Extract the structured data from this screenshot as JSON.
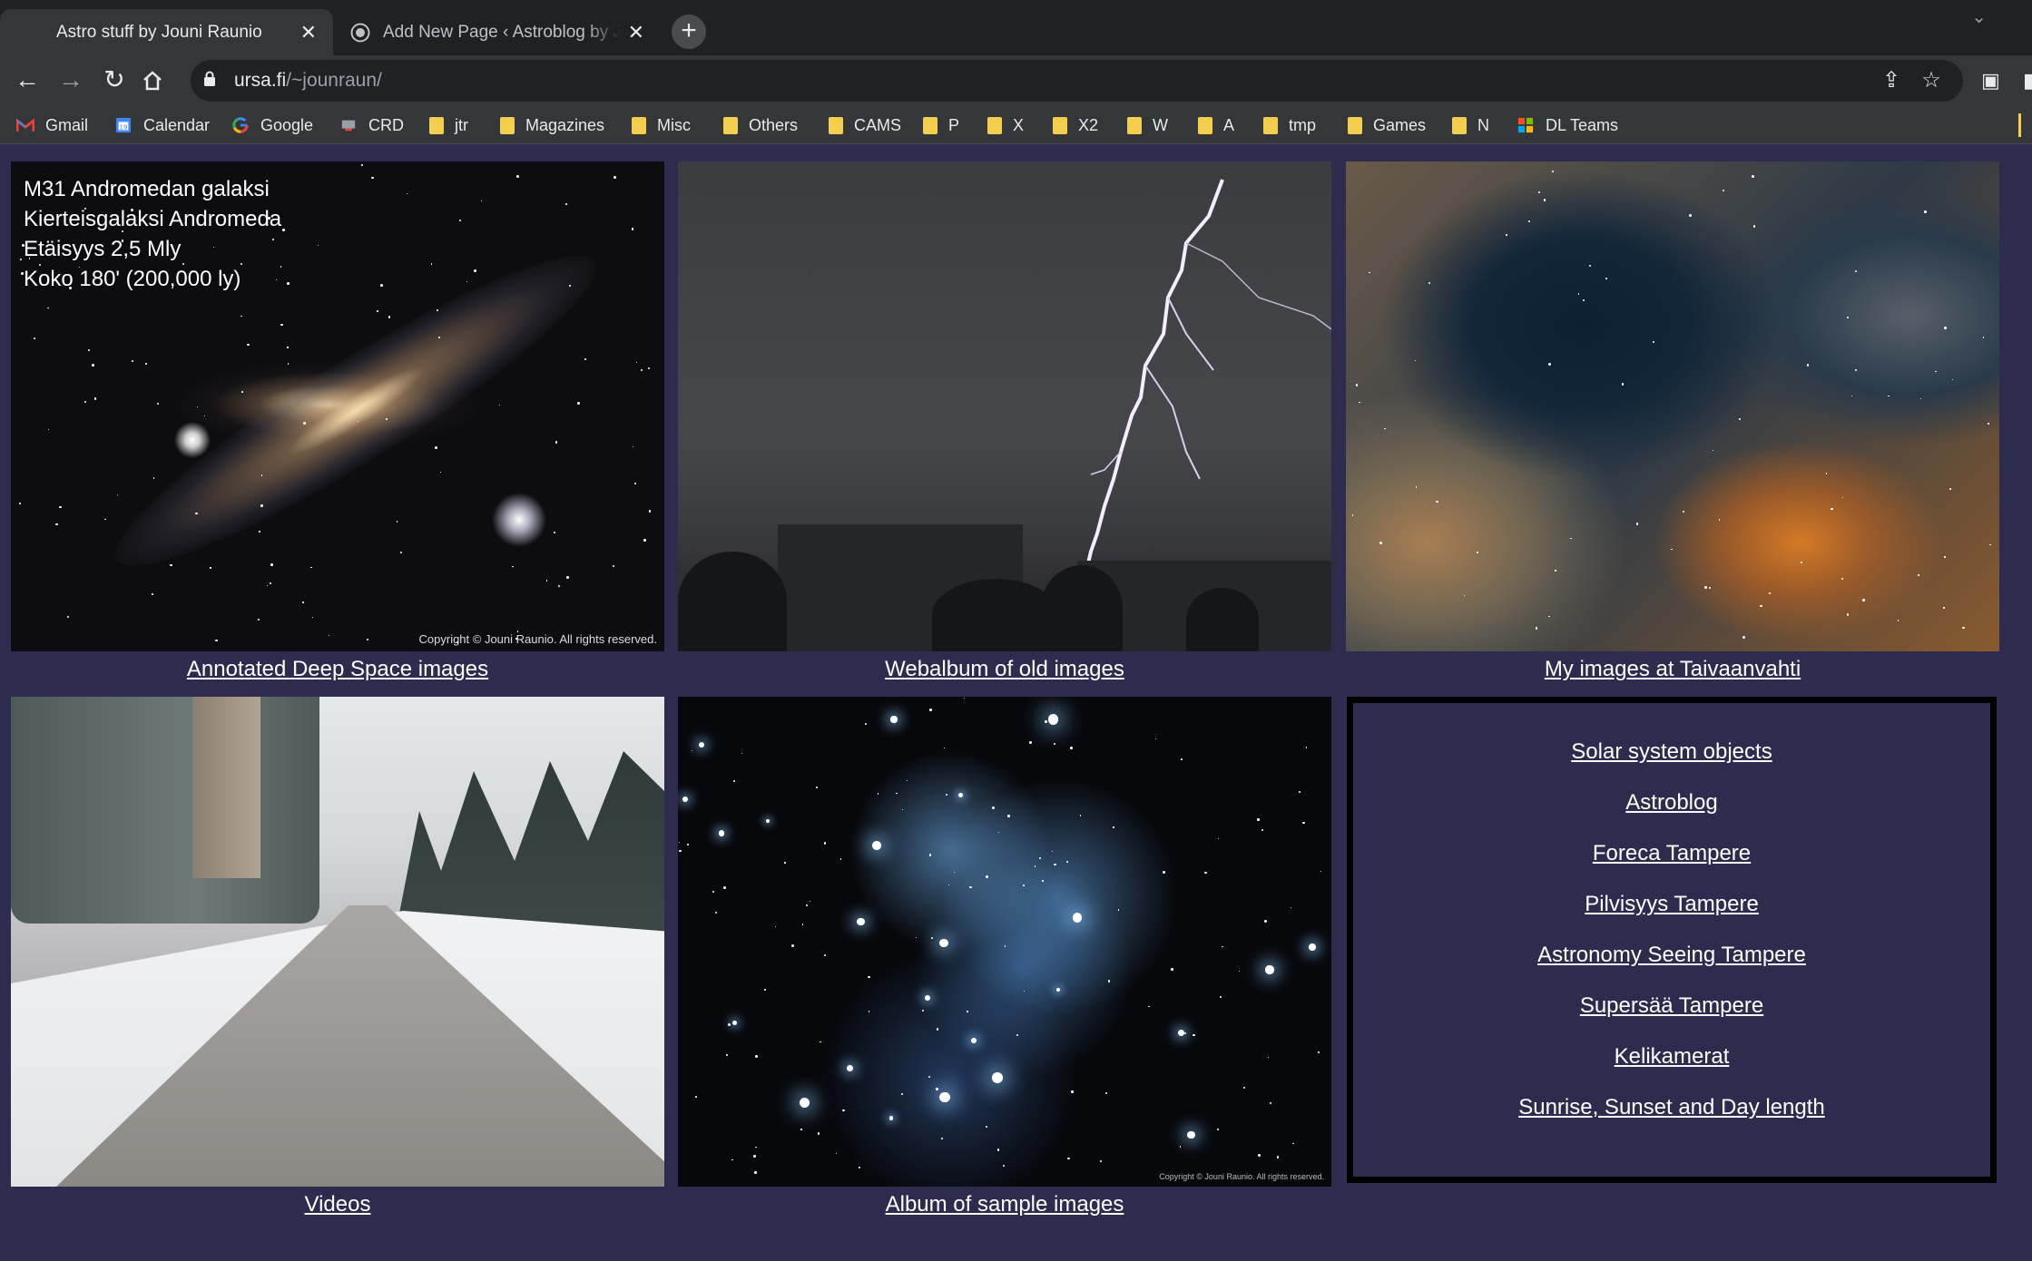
{
  "tabs": [
    {
      "title": "Astro stuff by Jouni Raunio",
      "active": true
    },
    {
      "title": "Add New Page ‹ Astroblog by Jouni Raunio",
      "active": false
    }
  ],
  "omnibox": {
    "host": "ursa.fi",
    "path": "/~jounraun/"
  },
  "bookmarks": [
    {
      "label": "Gmail",
      "icon": "gmail-icon"
    },
    {
      "label": "Calendar",
      "icon": "calendar-icon"
    },
    {
      "label": "Google",
      "icon": "google-icon"
    },
    {
      "label": "CRD",
      "icon": "crd-icon"
    },
    {
      "label": "jtr",
      "icon": "folder-icon"
    },
    {
      "label": "Magazines",
      "icon": "folder-icon"
    },
    {
      "label": "Misc",
      "icon": "folder-icon"
    },
    {
      "label": "Others",
      "icon": "folder-icon"
    },
    {
      "label": "CAMS",
      "icon": "folder-icon"
    },
    {
      "label": "P",
      "icon": "folder-icon"
    },
    {
      "label": "X",
      "icon": "folder-icon"
    },
    {
      "label": "X2",
      "icon": "folder-icon"
    },
    {
      "label": "W",
      "icon": "folder-icon"
    },
    {
      "label": "A",
      "icon": "folder-icon"
    },
    {
      "label": "tmp",
      "icon": "folder-icon"
    },
    {
      "label": "Games",
      "icon": "folder-icon"
    },
    {
      "label": "N",
      "icon": "folder-icon"
    },
    {
      "label": "DL Teams",
      "icon": "microsoft-icon"
    }
  ],
  "overlay": {
    "line1": "M31 Andromedan galaksi",
    "line2": "Kierteisgalaksi Andromeda",
    "line3": "Etäisyys 2,5 Mly",
    "line4": "Koko 180' (200,000 ly)",
    "copyright": "Copyright © Jouni Raunio. All rights reserved.",
    "copyright_small": "Copyright © Jouni Raunio. All rights reserved."
  },
  "gallery": {
    "andromeda": "Annotated Deep Space images",
    "lightning": "Webalbum of old images",
    "nebula": "My images at Taivaanvahti",
    "road": "Videos",
    "pleiades": "Album of sample images"
  },
  "links": [
    "Solar system objects",
    "Astroblog",
    "Foreca Tampere",
    "Pilvisyys Tampere",
    "Astronomy Seeing Tampere",
    "Supersää Tampere",
    "Kelikamerat",
    "Sunrise, Sunset and Day length"
  ],
  "colors": {
    "page_bg": "#2e2c4e",
    "chrome_dark": "#202124",
    "chrome": "#35363a",
    "folder": "#f4cf4f"
  }
}
